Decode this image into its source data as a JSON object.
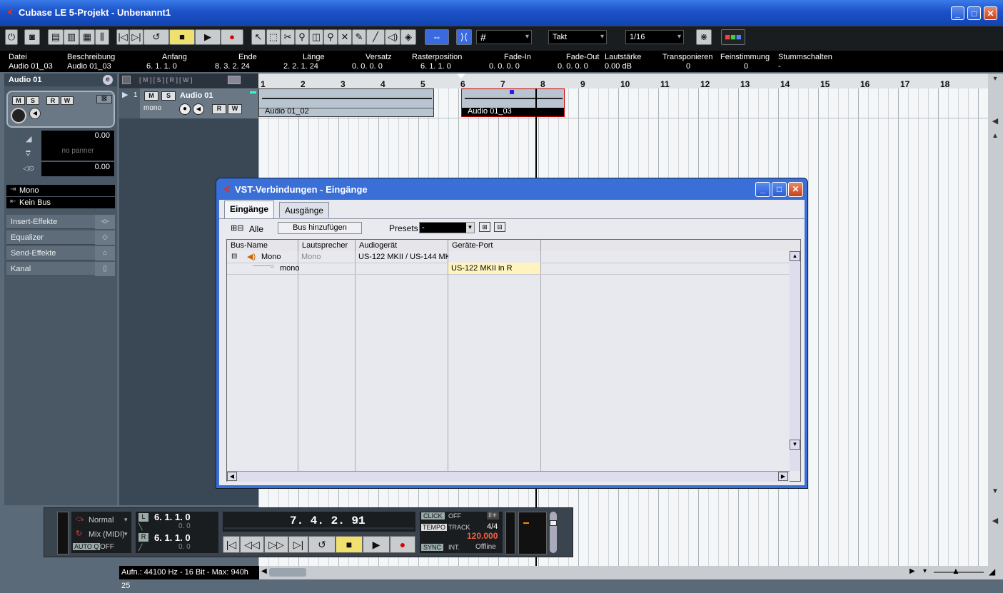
{
  "window": {
    "title": "Cubase LE 5-Projekt - Unbenannt1"
  },
  "toolbar": {
    "quantize_dd": "#",
    "grid_dd": "Takt",
    "quant_value_dd": "1/16"
  },
  "info_line": {
    "headers": [
      "Datei",
      "Beschreibung",
      "Anfang",
      "Ende",
      "Länge",
      "Versatz",
      "Rasterposition",
      "Fade-In",
      "Fade-Out",
      "Lautstärke",
      "Transponieren",
      "Feinstimmung",
      "Stummschalten"
    ],
    "values": [
      "Audio 01_03",
      "Audio 01_03",
      "6. 1. 1.    0",
      "8. 3. 2. 24",
      "2. 2. 1. 24",
      "0. 0. 0.    0",
      "6. 1. 1.    0",
      "0. 0. 0.    0",
      "0. 0. 0.    0",
      "0.00 dB",
      "0",
      "0",
      "-"
    ]
  },
  "inspector": {
    "title": "Audio 01",
    "btn_m": "M",
    "btn_s": "S",
    "btn_r": "R",
    "btn_w": "W",
    "volume": "0.00",
    "pan": "no panner",
    "delay": "0.00",
    "input_route": "Mono",
    "output_route": "Kein Bus",
    "sections": [
      "Insert-Effekte",
      "Equalizer",
      "Send-Effekte",
      "Kanal"
    ]
  },
  "track": {
    "number": "1",
    "name": "Audio 01",
    "mode": "mono",
    "btn_m": "M",
    "btn_s": "S",
    "btn_r": "R",
    "btn_w": "W"
  },
  "ruler": {
    "ticks": [
      "1",
      "2",
      "3",
      "4",
      "5",
      "6",
      "7",
      "8",
      "9",
      "10",
      "11",
      "12",
      "13",
      "14",
      "15",
      "16",
      "17",
      "18"
    ]
  },
  "events": [
    {
      "name": "Audio 01_02"
    },
    {
      "name": "Audio 01_03"
    }
  ],
  "dialog": {
    "title": "VST-Verbindungen - Eingänge",
    "tabs": [
      "Eingänge",
      "Ausgänge"
    ],
    "all_label": "Alle",
    "add_bus": "Bus hinzufügen",
    "presets_label": "Presets",
    "presets_value": "-",
    "columns": [
      "Bus-Name",
      "Lautsprecher",
      "Audiogerät",
      "Geräte-Port"
    ],
    "rows": [
      {
        "bus": "Mono",
        "speaker": "Mono",
        "device": "US-122 MKII / US-144 MK",
        "port": ""
      },
      {
        "bus": "mono",
        "speaker": "",
        "device": "",
        "port": "US-122 MKII in R"
      }
    ]
  },
  "transport": {
    "mode_normal": "Normal",
    "mode_mix": "Mix (MIDI)",
    "autoq": "AUTO Q",
    "autoq_state": "OFF",
    "left_locator": "6.  1.  1.    0",
    "left_locator_sub": "0.    0",
    "right_locator": "6.  1.  1.    0",
    "right_locator_sub": "0.    0",
    "position": "7. 4. 2. 91",
    "click": "CLICK",
    "click_state": "OFF",
    "tempo": "TEMPO",
    "track_label": "TRACK",
    "signature": "4/4",
    "tempo_value": "120.000",
    "sync": "SYNC",
    "sync_int": "INT.",
    "sync_state": "Offline"
  },
  "status": {
    "text": "Aufn.: 44100 Hz - 16 Bit - Max: 940h 25"
  }
}
